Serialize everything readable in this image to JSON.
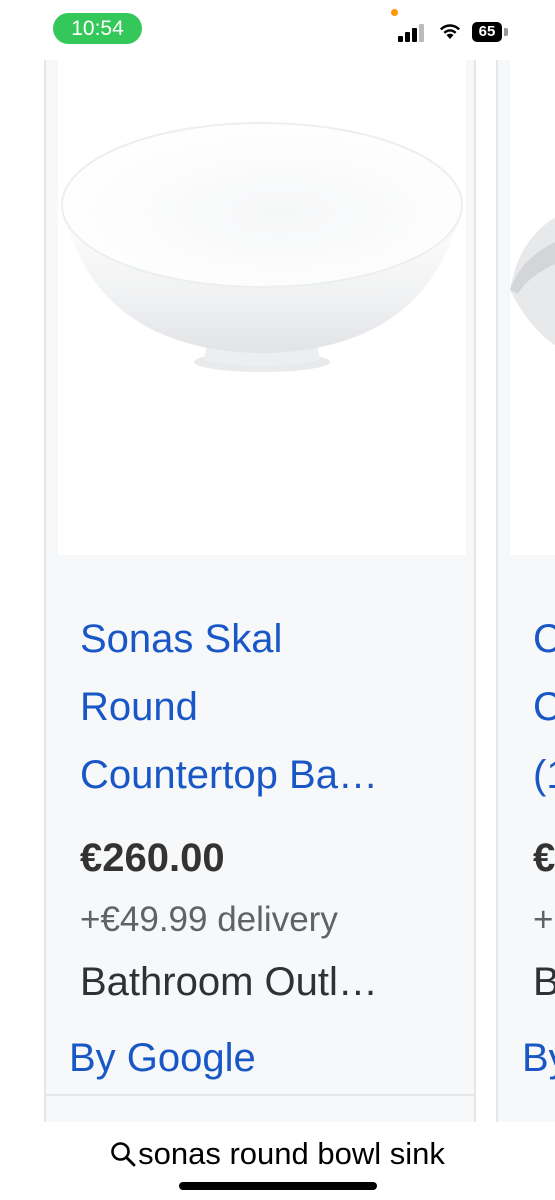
{
  "status_bar": {
    "time": "10:54",
    "battery": "65"
  },
  "product_card": {
    "title_lines": [
      "Sonas Skal",
      "Round",
      "Countertop Ba…"
    ],
    "price": "€260.00",
    "delivery": "+€49.99 delivery",
    "store": "Bathroom Outl…",
    "by_google": "By Google"
  },
  "partial_card": {
    "title_lines": [
      "C",
      "C",
      "(1"
    ],
    "price": "€",
    "delivery": "+",
    "store": "B",
    "by_google": "By"
  },
  "search_bar": {
    "query": "sonas round bowl sink",
    "icon": "search-icon"
  },
  "colors": {
    "link_blue": "#1a57c6",
    "time_pill_green": "#34c759",
    "card_background": "#f7f8f9"
  }
}
